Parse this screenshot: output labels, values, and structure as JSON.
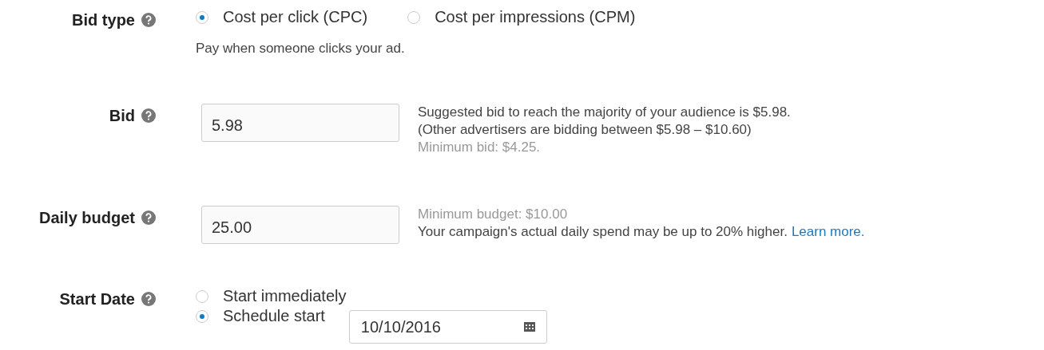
{
  "bid_type": {
    "label": "Bid type",
    "options": [
      {
        "label": "Cost per click (CPC)",
        "selected": true
      },
      {
        "label": "Cost per impressions (CPM)",
        "selected": false
      }
    ],
    "description": "Pay when someone clicks your ad."
  },
  "bid": {
    "label": "Bid",
    "value": "5.98",
    "notes": [
      {
        "kind": "normal",
        "text": "Suggested bid to reach the majority of your audience is $5.98."
      },
      {
        "kind": "normal",
        "text": "(Other advertisers are bidding between $5.98 – $10.60)"
      },
      {
        "kind": "muted",
        "text": "Minimum bid: $4.25."
      }
    ]
  },
  "daily_budget": {
    "label": "Daily budget",
    "value": "25.00",
    "notes": [
      {
        "kind": "muted",
        "text": "Minimum budget: $10.00"
      },
      {
        "kind": "normal",
        "text": "Your campaign's actual daily spend may be up to 20% higher.",
        "link": "Learn more."
      }
    ]
  },
  "start_date": {
    "label": "Start Date",
    "options": [
      {
        "label": "Start immediately",
        "selected": false
      },
      {
        "label": "Schedule start",
        "selected": true,
        "date": "10/10/2016"
      }
    ]
  }
}
